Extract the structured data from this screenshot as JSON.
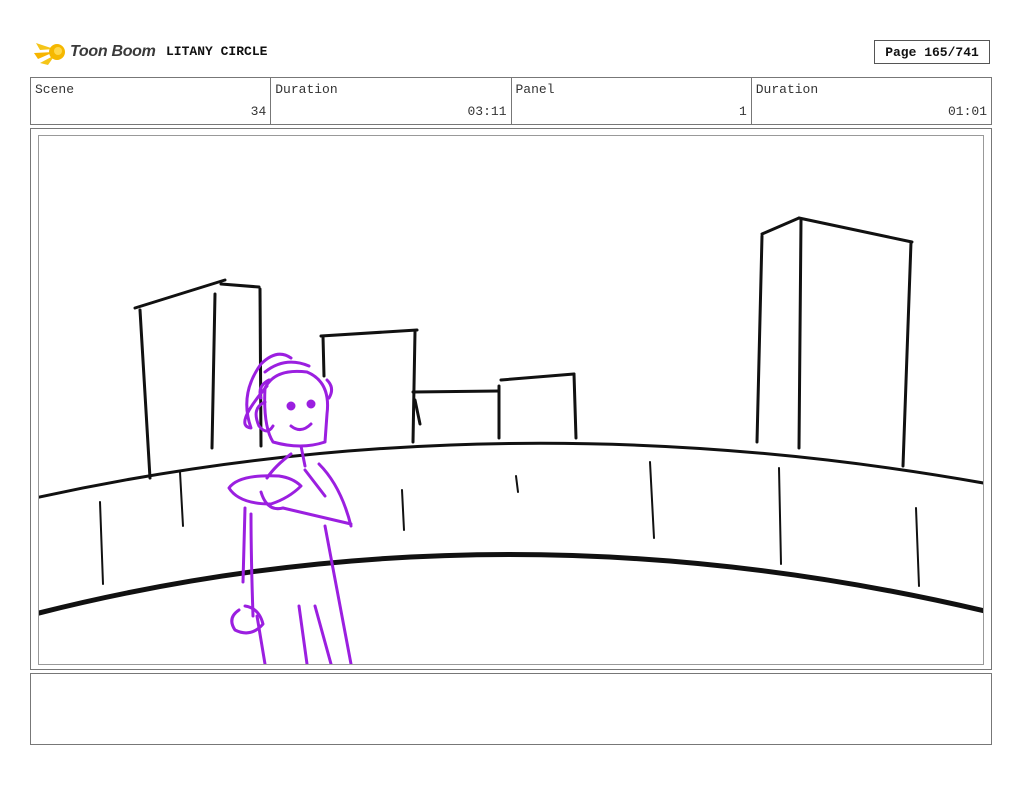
{
  "header": {
    "logo_text": "Toon Boom",
    "title": "LITANY CIRCLE",
    "page_indicator": "Page 165/741"
  },
  "info": {
    "scene_label": "Scene",
    "scene_value": "34",
    "duration_label": "Duration",
    "duration_value": "03:11",
    "panel_label": "Panel",
    "panel_value": "1",
    "panel_duration_label": "Duration",
    "panel_duration_value": "01:01"
  },
  "drawing": {
    "background_ink": "#111111",
    "character_ink": "#9b1fe0",
    "logo_color": "#f5c518"
  },
  "notes": {
    "text": ""
  }
}
